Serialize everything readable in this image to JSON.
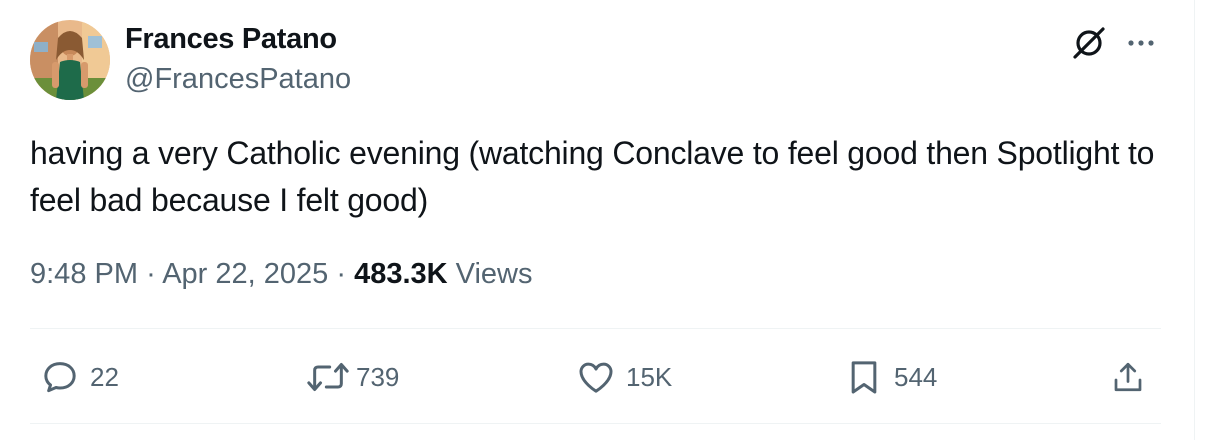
{
  "author": {
    "name": "Frances Patano",
    "handle": "@FrancesPatano"
  },
  "header_icons": [
    "grok-icon",
    "more-options-icon"
  ],
  "tweet": {
    "text": "having a very Catholic evening (watching Conclave to feel good then Spotlight to feel bad because I felt good)"
  },
  "meta": {
    "time": "9:48 PM",
    "separator": "·",
    "date": "Apr 22, 2025",
    "views_count": "483.3K",
    "views_label": "Views"
  },
  "actions": {
    "replies": "22",
    "reposts": "739",
    "likes": "15K",
    "bookmarks": "544"
  },
  "colors": {
    "text": "#0f1419",
    "secondary": "#536471",
    "divider": "#eff3f4"
  }
}
